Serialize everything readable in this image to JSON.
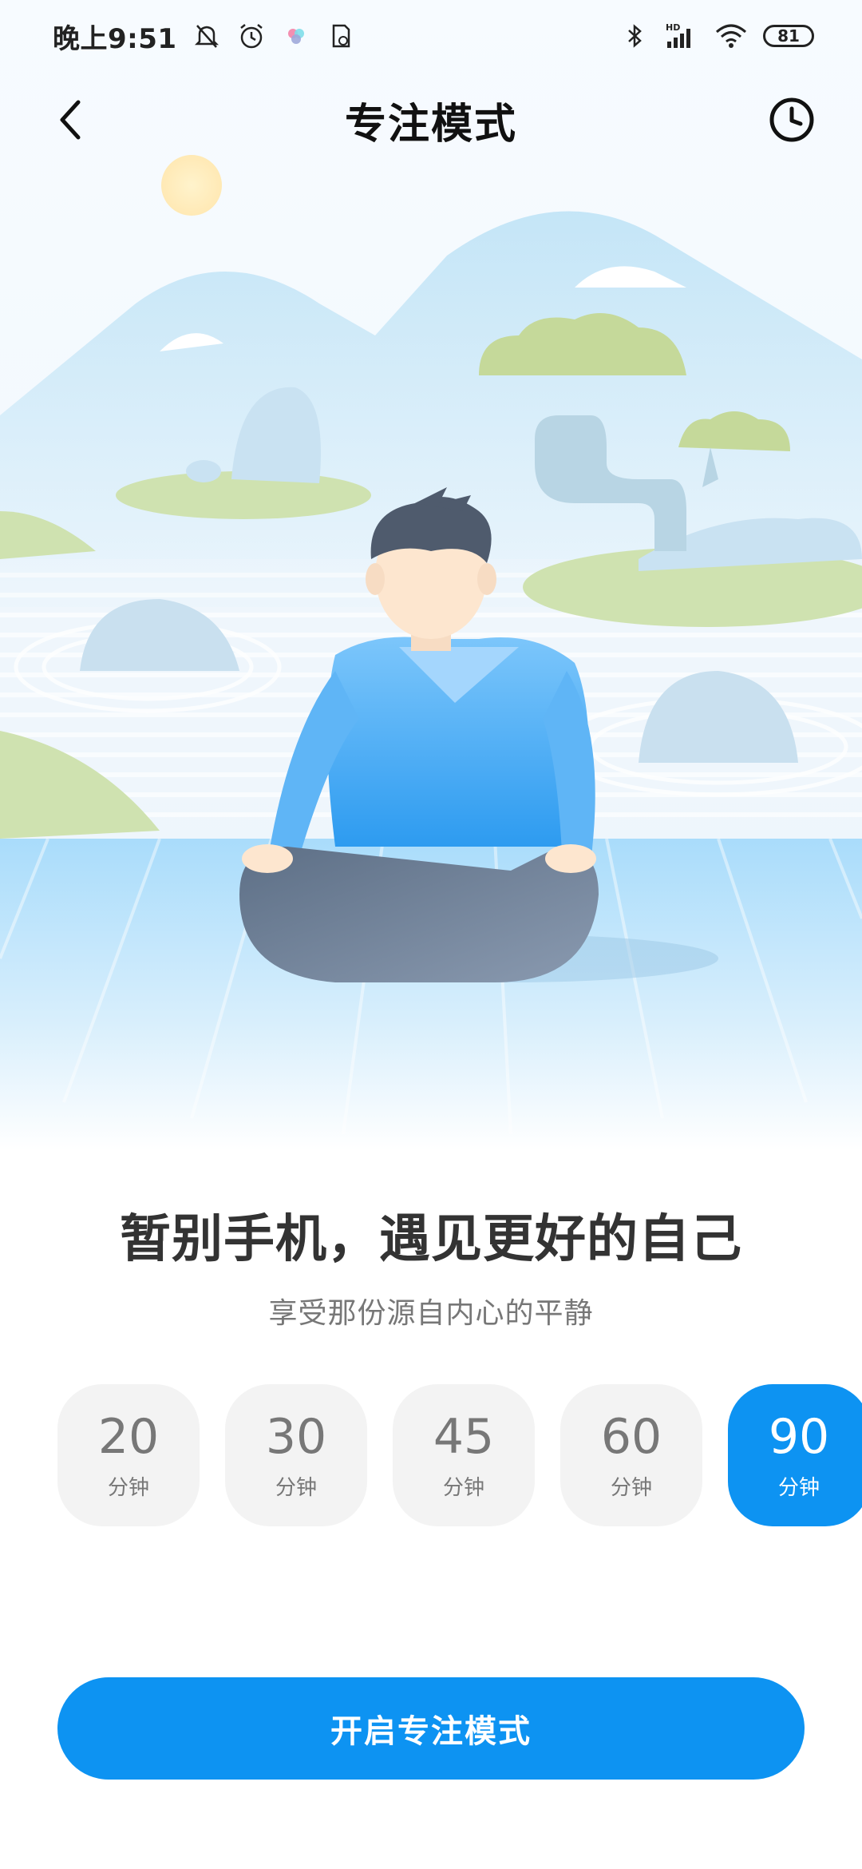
{
  "status_bar": {
    "time": "晚上9:51",
    "battery": "81",
    "icons": [
      "mute-bell-icon",
      "alarm-icon",
      "app-notification-icon",
      "file-icon",
      "bluetooth-icon",
      "hd-signal-icon",
      "wifi-icon",
      "battery-icon"
    ]
  },
  "header": {
    "title": "专注模式",
    "back_icon": "chevron-left-icon",
    "history_icon": "clock-icon"
  },
  "content": {
    "headline": "暂别手机，遇见更好的自己",
    "subline": "享受那份源自内心的平静"
  },
  "durations": [
    {
      "value": "20",
      "unit": "分钟",
      "selected": false
    },
    {
      "value": "30",
      "unit": "分钟",
      "selected": false
    },
    {
      "value": "45",
      "unit": "分钟",
      "selected": false
    },
    {
      "value": "60",
      "unit": "分钟",
      "selected": false
    },
    {
      "value": "90",
      "unit": "分钟",
      "selected": true
    }
  ],
  "start_button": {
    "label": "开启专注模式"
  },
  "colors": {
    "accent": "#0d93f2",
    "chip_bg": "#f3f3f3",
    "text_dark": "#333333"
  }
}
